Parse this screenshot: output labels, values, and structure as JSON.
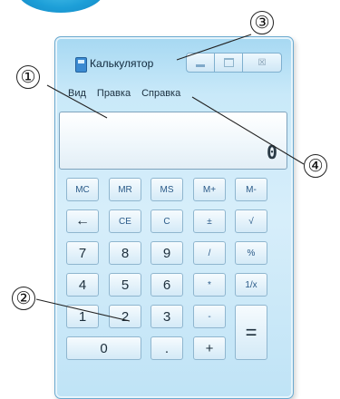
{
  "window": {
    "title": "Калькулятор",
    "minimize_icon": "minimize-icon",
    "maximize_icon": "maximize-icon",
    "close_label": "☒"
  },
  "menu": [
    "Вид",
    "Правка",
    "Справка"
  ],
  "display": {
    "value": "0"
  },
  "keys": {
    "row1": [
      "MC",
      "MR",
      "MS",
      "M+",
      "M-"
    ],
    "row2": [
      "←",
      "CE",
      "C",
      "±",
      "√"
    ],
    "row3": [
      "7",
      "8",
      "9",
      "/",
      "%"
    ],
    "row4": [
      "4",
      "5",
      "6",
      "*",
      "1/x"
    ],
    "row5": [
      "1",
      "2",
      "3",
      "-"
    ],
    "row6": [
      "0",
      ".",
      "+"
    ],
    "equals": "="
  },
  "callouts": [
    "①",
    "②",
    "③",
    "④"
  ],
  "colors": {
    "accent_blob": "#1d9fd8",
    "window_frame": "#a6d8f2"
  }
}
